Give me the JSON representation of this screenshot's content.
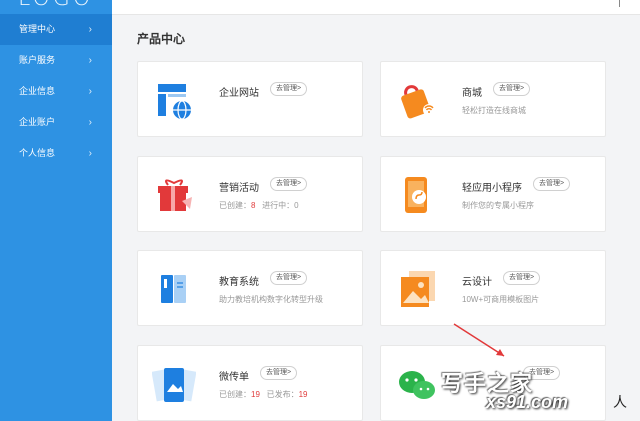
{
  "logo": "LOGO",
  "sidebar": {
    "items": [
      {
        "label": "管理中心",
        "active": true
      },
      {
        "label": "账户服务",
        "active": false
      },
      {
        "label": "企业信息",
        "active": false
      },
      {
        "label": "企业账户",
        "active": false
      },
      {
        "label": "个人信息",
        "active": false
      }
    ]
  },
  "main": {
    "section_title": "产品中心",
    "manage_label": "去管理>",
    "cards": [
      {
        "name": "企业网站",
        "desc": ""
      },
      {
        "name": "商城",
        "desc": "轻松打造在线商城"
      },
      {
        "name": "营销活动",
        "desc_prefix": "已创建：",
        "count1": "8",
        "desc_mid": "进行中：",
        "count2": "0"
      },
      {
        "name": "轻应用小程序",
        "desc": "制作您的专属小程序"
      },
      {
        "name": "教育系统",
        "desc": "助力教培机构数字化转型升级"
      },
      {
        "name": "云设计",
        "desc": "10W+可商用模板图片"
      },
      {
        "name": "微传单",
        "desc_prefix": "已创建：",
        "count1": "19",
        "desc_mid": "已发布：",
        "count2": "19"
      },
      {
        "name": "",
        "desc": ""
      }
    ]
  },
  "watermark": {
    "line1": "写手之家",
    "line2": "xs91.com",
    "suffix": "人"
  },
  "colors": {
    "sidebar": "#2e92e3",
    "sidebar_active": "#1f7ed2",
    "accent_red": "#e03c3c",
    "icon_blue": "#1e7fe0",
    "icon_orange": "#f58a1f",
    "icon_red": "#e2393a"
  }
}
